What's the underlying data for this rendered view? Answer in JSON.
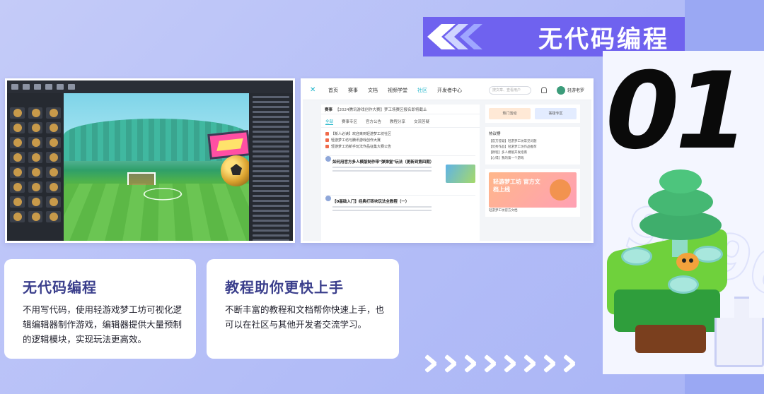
{
  "header": {
    "title": "无代码编程",
    "number": "01"
  },
  "watermark": "9596",
  "cards": [
    {
      "title": "无代码编程",
      "body": "不用写代码，使用轻游戏梦工坊可视化逻辑编辑器制作游戏，编辑器提供大量预制的逻辑模块，实现玩法更高效。"
    },
    {
      "title": "教程助你更快上手",
      "body": "不断丰富的教程和文档帮你快速上手，也可以在社区与其他开发者交流学习。"
    }
  ],
  "site": {
    "logo": "✕",
    "nav": [
      "首页",
      "赛事",
      "文档",
      "视频学堂",
      "社区",
      "开发者中心"
    ],
    "nav_active_index": 4,
    "search_placeholder": "搜文章、查看用户",
    "user_name": "轻游老罗",
    "notice_label": "赛事",
    "notice_text": "【2024腾讯游戏创作大赛】梦工场赛区报名即将截止",
    "tabs": [
      "全部",
      "赛事专区",
      "官方公告",
      "教程分享",
      "交流答疑"
    ],
    "posts": [
      "【新人必读】欢迎来到轻游梦工坊社区",
      "轻游梦工坊与腾讯游戏创作大赛",
      "轻游梦工坊新手玩法作品征集大赛公告"
    ],
    "article_titles": [
      "如何用官方多人模版制作带\"弹弹堂\"玩法（更新到第四期）",
      "【0基础入门】经典打砖块玩法全教程（一）"
    ],
    "side_buttons": [
      "热门活动",
      "答疑专区"
    ],
    "side_heading": "热议榜",
    "side_rows": [
      "【官方答疑】轻游梦工坊常见问题",
      "【优秀作品】轻游梦工坊作品推荐",
      "【教程】多人模版开发指南",
      "【心得】我的第一个游戏"
    ],
    "banner_text": "轻游梦工坊 官方文档上线",
    "banner_caption": "轻游梦工坊官方文档"
  },
  "colors": {
    "background": "#b3bdf7",
    "banner": "#6f62ef",
    "card_title": "#3b3f8c",
    "accent": "#19b3c8"
  }
}
